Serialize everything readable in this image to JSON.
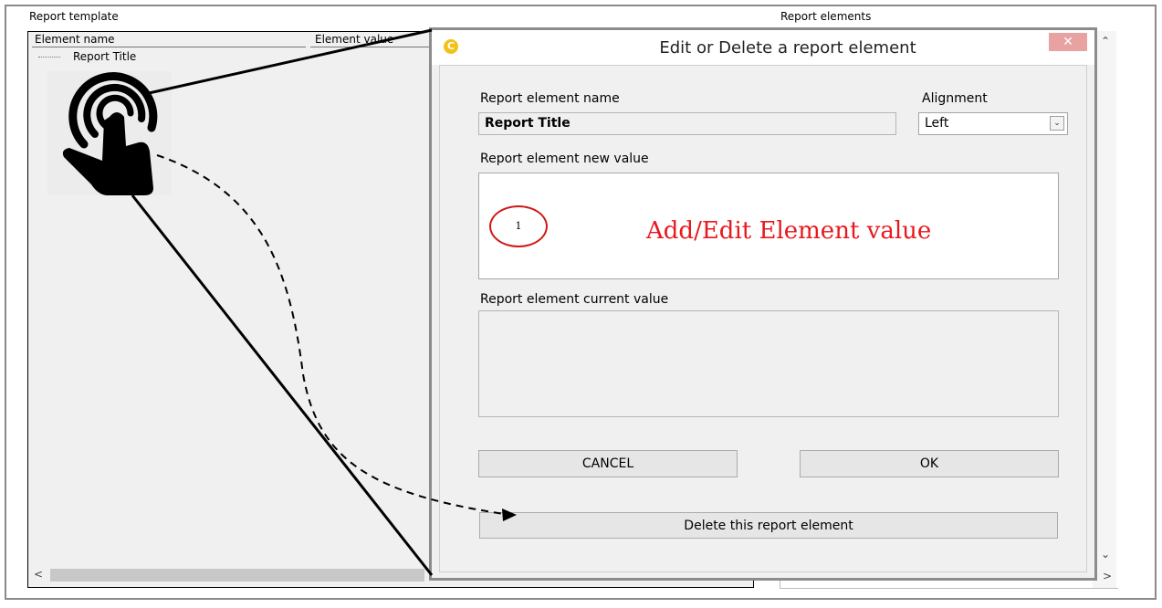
{
  "main_window": {
    "report_template_label": "Report template",
    "report_elements_label": "Report elements",
    "columns": {
      "name": "Element name",
      "value": "Element value"
    },
    "tree_items": [
      "Report Title"
    ]
  },
  "dialog": {
    "title": "Edit or Delete a report element",
    "name_label": "Report element name",
    "name_value": "Report Title",
    "alignment_label": "Alignment",
    "alignment_value": "Left",
    "new_value_label": "Report element new value",
    "current_value_label": "Report element current value",
    "current_value": "",
    "cancel_label": "CANCEL",
    "ok_label": "OK",
    "delete_label": "Delete this report element"
  },
  "annotation": {
    "step_number": "1",
    "text": "Add/Edit Element value",
    "color": "#e8191e"
  },
  "icons": {
    "hand": "tap-hand-icon",
    "app": "app-logo-icon",
    "close": "close-icon",
    "dropdown": "chevron-down-icon"
  }
}
